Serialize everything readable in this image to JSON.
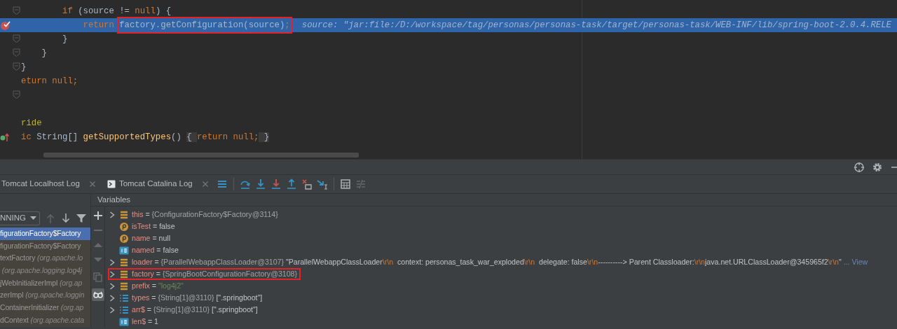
{
  "editor": {
    "lines": [
      {
        "kind": "fold",
        "highlighted": false,
        "tokens": [
          {
            "text": "        if",
            "kind": "keyword"
          },
          {
            "text": " (source != ",
            "kind": "plain"
          },
          {
            "text": "null",
            "kind": "keyword"
          },
          {
            "text": ") {",
            "kind": "plain"
          }
        ]
      },
      {
        "kind": "breakpoint",
        "highlighted": true,
        "tokens": [
          {
            "text": "            return ",
            "kind": "keyword"
          },
          {
            "text": "factory.getConfiguration(source)",
            "kind": "plain",
            "boxed": true
          },
          {
            "text": ";",
            "kind": "keyword",
            "boxed": true
          },
          {
            "text": "source: \"jar:file:/D:/workspace/tag/personas/personas-task/target/personas-task/WEB-INF/lib/spring-boot-2.0.4.RELE",
            "kind": "hint"
          }
        ]
      },
      {
        "kind": "fold",
        "highlighted": false,
        "tokens": [
          {
            "text": "        }",
            "kind": "plain"
          }
        ]
      },
      {
        "kind": "fold",
        "highlighted": false,
        "tokens": [
          {
            "text": "    }",
            "kind": "plain"
          }
        ]
      },
      {
        "kind": "fold",
        "highlighted": false,
        "tokens": [
          {
            "text": "}",
            "kind": "plain"
          }
        ]
      },
      {
        "kind": "none",
        "highlighted": false,
        "tokens": [
          {
            "text": "eturn ",
            "kind": "keyword"
          },
          {
            "text": "null",
            "kind": "keyword"
          },
          {
            "text": ";",
            "kind": "keyword"
          }
        ]
      },
      {
        "kind": "fold",
        "highlighted": false
      },
      {
        "kind": "none",
        "highlighted": false
      },
      {
        "kind": "none",
        "highlighted": false,
        "tokens": [
          {
            "text": "ride",
            "kind": "annotation"
          }
        ]
      },
      {
        "kind": "override",
        "highlighted": false,
        "tokens": [
          {
            "text": "ic ",
            "kind": "keyword"
          },
          {
            "text": "String[] ",
            "kind": "plain"
          },
          {
            "text": "getSupportedTypes",
            "kind": "method"
          },
          {
            "text": "() ",
            "kind": "plain"
          },
          {
            "text": "{ ",
            "kind": "fold"
          },
          {
            "text": "return null;",
            "kind": "keyword"
          },
          {
            "text": " }",
            "kind": "fold"
          }
        ]
      }
    ]
  },
  "debugger": {
    "header_icons": [
      {
        "kind": "crosshair"
      },
      {
        "kind": "gear"
      },
      {
        "kind": "minimize"
      }
    ],
    "tabs": [
      {
        "label": "Tomcat Localhost Log",
        "has_icon": false,
        "selected": false
      },
      {
        "label": "Tomcat Catalina Log",
        "has_icon": true,
        "selected": false
      }
    ],
    "toolbar": [
      {
        "kind": "menu",
        "disabled": false
      },
      {
        "kind": "step-over",
        "disabled": false
      },
      {
        "kind": "step-into",
        "disabled": false
      },
      {
        "kind": "force-step-into",
        "disabled": false
      },
      {
        "kind": "step-out",
        "disabled": false
      },
      {
        "kind": "drop-frame",
        "disabled": false
      },
      {
        "kind": "run-to-cursor",
        "disabled": false
      },
      {
        "kind": "evaluate",
        "disabled": false
      },
      {
        "kind": "trace",
        "disabled": true
      }
    ],
    "thread_dropdown": {
      "value": "NNING"
    },
    "frame_nav": [
      {
        "kind": "up",
        "disabled": true
      },
      {
        "kind": "down",
        "disabled": false
      },
      {
        "kind": "filter",
        "disabled": false
      }
    ],
    "frames": [
      {
        "method": "figurationFactory$Factory",
        "selected": true
      },
      {
        "method": "figurationFactory$Factory",
        "selected": false
      },
      {
        "method": "textFactory",
        "package": "(org.apache.lo",
        "selected": false
      },
      {
        "package": "(org.apache.logging.log4j",
        "selected": false
      },
      {
        "method": "jWebInitializerImpl",
        "package": "(org.ap",
        "selected": false
      },
      {
        "method": "zerImpl",
        "package": "(org.apache.loggin",
        "selected": false
      },
      {
        "method": "ContainerInitializer",
        "package": "(org.ap",
        "selected": false
      },
      {
        "method": "dContext",
        "package": "(org.apache.cata",
        "selected": false
      }
    ],
    "variables_title": "Variables",
    "side_tools": [
      {
        "kind": "plus",
        "disabled": false,
        "on": false
      },
      {
        "kind": "minus",
        "disabled": true,
        "on": false
      },
      {
        "kind": "up",
        "disabled": true,
        "on": false
      },
      {
        "kind": "down",
        "disabled": true,
        "on": false
      },
      {
        "kind": "copy",
        "disabled": true,
        "on": false
      },
      {
        "kind": "glasses",
        "disabled": false,
        "on": true
      }
    ],
    "variables": [
      {
        "expandable": true,
        "kind": "field",
        "boxed": false,
        "tokens": [
          {
            "text": "this",
            "kind": "name"
          },
          {
            "text": " = ",
            "kind": "plain"
          },
          {
            "text": "{ConfigurationFactory$Factory@3114}",
            "kind": "ref"
          }
        ]
      },
      {
        "expandable": false,
        "kind": "param",
        "boxed": false,
        "tokens": [
          {
            "text": "isTest",
            "kind": "name"
          },
          {
            "text": " = false",
            "kind": "plain"
          }
        ]
      },
      {
        "expandable": false,
        "kind": "param",
        "boxed": false,
        "tokens": [
          {
            "text": "name",
            "kind": "name"
          },
          {
            "text": " = null",
            "kind": "plain"
          }
        ]
      },
      {
        "expandable": false,
        "kind": "primitive",
        "boxed": false,
        "tokens": [
          {
            "text": "named",
            "kind": "name"
          },
          {
            "text": " = false",
            "kind": "plain"
          }
        ]
      },
      {
        "expandable": true,
        "kind": "field",
        "boxed": false,
        "tokens": [
          {
            "text": "loader",
            "kind": "name"
          },
          {
            "text": " = ",
            "kind": "plain"
          },
          {
            "text": "{ParallelWebappClassLoader@3107}",
            "kind": "ref"
          },
          {
            "text": " \"ParallelWebappClassLoader",
            "kind": "plain"
          },
          {
            "text": "\\r\\n",
            "kind": "escape"
          },
          {
            "text": "  context: personas_task_war_exploded",
            "kind": "plain"
          },
          {
            "text": "\\r\\n",
            "kind": "escape"
          },
          {
            "text": "  delegate: false",
            "kind": "plain"
          },
          {
            "text": "\\r\\n",
            "kind": "escape"
          },
          {
            "text": "----------> Parent Classloader:",
            "kind": "plain"
          },
          {
            "text": "\\r\\n",
            "kind": "escape"
          },
          {
            "text": "java.net.URLClassLoader@345965f2",
            "kind": "plain"
          },
          {
            "text": "\\r\\n",
            "kind": "escape"
          },
          {
            "text": "\"",
            "kind": "plain"
          },
          {
            "text": " ... View",
            "kind": "link"
          }
        ]
      },
      {
        "expandable": true,
        "kind": "field",
        "boxed": true,
        "tokens": [
          {
            "text": "factory",
            "kind": "name"
          },
          {
            "text": " = ",
            "kind": "plain"
          },
          {
            "text": "{SpringBootConfigurationFactory@3108}",
            "kind": "ref"
          }
        ]
      },
      {
        "expandable": true,
        "kind": "field",
        "boxed": false,
        "tokens": [
          {
            "text": "prefix",
            "kind": "name"
          },
          {
            "text": " = ",
            "kind": "plain"
          },
          {
            "text": "\"log4j2\"",
            "kind": "string"
          }
        ]
      },
      {
        "expandable": true,
        "kind": "array",
        "boxed": false,
        "tokens": [
          {
            "text": "types",
            "kind": "name"
          },
          {
            "text": " = ",
            "kind": "plain"
          },
          {
            "text": "{String[1]@3110}",
            "kind": "ref"
          },
          {
            "text": " [\".springboot\"]",
            "kind": "plain"
          }
        ]
      },
      {
        "expandable": true,
        "kind": "array",
        "boxed": false,
        "tokens": [
          {
            "text": "arr$",
            "kind": "name"
          },
          {
            "text": " = ",
            "kind": "plain"
          },
          {
            "text": "{String[1]@3110}",
            "kind": "ref"
          },
          {
            "text": " [\".springboot\"]",
            "kind": "plain"
          }
        ]
      },
      {
        "expandable": false,
        "kind": "primitive",
        "boxed": false,
        "tokens": [
          {
            "text": "len$",
            "kind": "name"
          },
          {
            "text": " = 1",
            "kind": "plain"
          }
        ]
      }
    ]
  }
}
